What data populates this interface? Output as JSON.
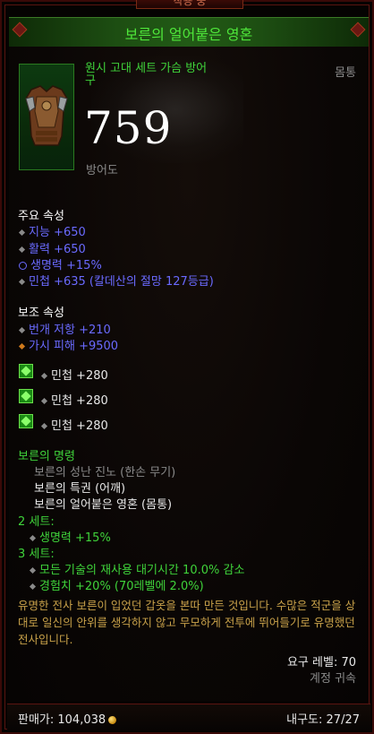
{
  "header": {
    "top_tab": "착용 중",
    "item_name": "보른의 얼어붙은 영혼"
  },
  "item": {
    "type_line1": "원시 고대 세트 가슴 방어",
    "type_line2": "구",
    "slot": "몸통",
    "armor_value": "759",
    "armor_label": "방어도",
    "icon": "chest-armor-icon"
  },
  "primary": {
    "title": "주요 속성",
    "stats": [
      {
        "text": "지능 +650",
        "bullet": "diamond"
      },
      {
        "text": "활력 +650",
        "bullet": "diamond"
      },
      {
        "text": "생명력 +15%",
        "bullet": "reroll"
      },
      {
        "text": "민첩 +635 (칼데산의 절망 127등급)",
        "bullet": "diamond"
      }
    ]
  },
  "secondary": {
    "title": "보조 속성",
    "stats": [
      {
        "text": "번개 저항 +210",
        "bullet": "diamond"
      },
      {
        "text": "가시 피해 +9500",
        "bullet": "orange-diamond"
      }
    ]
  },
  "sockets": [
    {
      "text": "민첩 +280",
      "icon": "emerald-gem-icon"
    },
    {
      "text": "민첩 +280",
      "icon": "emerald-gem-icon"
    },
    {
      "text": "민첩 +280",
      "icon": "emerald-gem-icon"
    }
  ],
  "set": {
    "name": "보른의 명령",
    "pieces": [
      {
        "text": "보른의 성난 진노 (한손 무기)",
        "owned": false
      },
      {
        "text": "보른의 특권 (어깨)",
        "owned": true
      },
      {
        "text": "보른의 얼어붙은 영혼 (몸통)",
        "owned": true
      }
    ],
    "bonus2_title": "2 세트:",
    "bonus2": [
      "생명력 +15%"
    ],
    "bonus3_title": "3 세트:",
    "bonus3": [
      "모든 기술의 재사용 대기시간 10.0% 감소",
      "경험치 +20% (70레벨에 2.0%)"
    ]
  },
  "flavor": "유명한 전사 보른이 입었던 갑옷을 본따 만든 것입니다. 수많은 적군을 상대로 일신의 안위를 생각하지 않고 무모하게 전투에 뛰어들기로 유명했던 전사입니다.",
  "requirements": {
    "level": "요구 레벨: 70",
    "bound": "계정 귀속"
  },
  "footer": {
    "sell_label": "판매가: 104,038",
    "durability": "내구도: 27/27",
    "coin_icon": "gold-coin-icon"
  },
  "colors": {
    "set_green": "#3fd33a",
    "magic_blue": "#6a6aff",
    "flavor_gold": "#c9a24a",
    "frame_red": "#5a1410"
  }
}
